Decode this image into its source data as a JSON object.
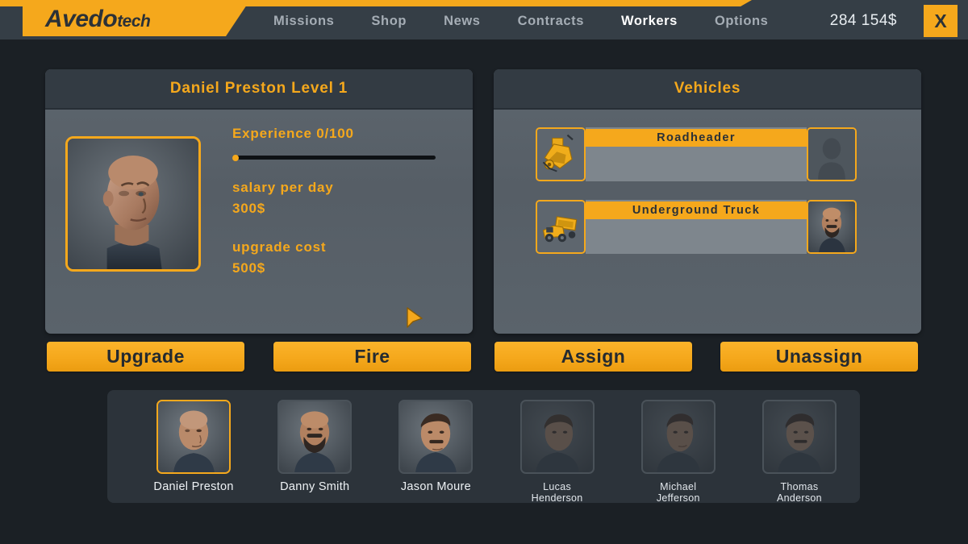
{
  "header": {
    "logo_main": "Avedo",
    "logo_sub": "tech",
    "nav": [
      {
        "label": "Missions",
        "active": false
      },
      {
        "label": "Shop",
        "active": false
      },
      {
        "label": "News",
        "active": false
      },
      {
        "label": "Contracts",
        "active": false
      },
      {
        "label": "Workers",
        "active": true
      },
      {
        "label": "Options",
        "active": false
      }
    ],
    "money": "284 154$",
    "close_label": "X",
    "accent_color": "#f5a81c"
  },
  "worker_panel": {
    "title": "Daniel Preston Level 1",
    "experience_label": "Experience  0/100",
    "experience_current": 0,
    "experience_max": 100,
    "salary_label": "salary per day",
    "salary_value": "300$",
    "upgrade_label": "upgrade cost",
    "upgrade_value": "500$"
  },
  "vehicle_panel": {
    "title": "Vehicles",
    "vehicles": [
      {
        "name": "Roadheader",
        "driver_assigned": false,
        "art": "roadheader"
      },
      {
        "name": "Underground Truck",
        "driver_assigned": true,
        "art": "truck"
      }
    ]
  },
  "actions": {
    "upgrade": "Upgrade",
    "fire": "Fire",
    "assign": "Assign",
    "unassign": "Unassign"
  },
  "worker_list": [
    {
      "name": "Daniel Preston",
      "selected": true,
      "locked": false
    },
    {
      "name": "Danny Smith",
      "selected": false,
      "locked": false
    },
    {
      "name": "Jason Moure",
      "selected": false,
      "locked": false
    },
    {
      "name": "Lucas\nHenderson",
      "selected": false,
      "locked": true
    },
    {
      "name": "Michael\nJefferson",
      "selected": false,
      "locked": true
    },
    {
      "name": "Thomas\nAnderson",
      "selected": false,
      "locked": true
    }
  ]
}
